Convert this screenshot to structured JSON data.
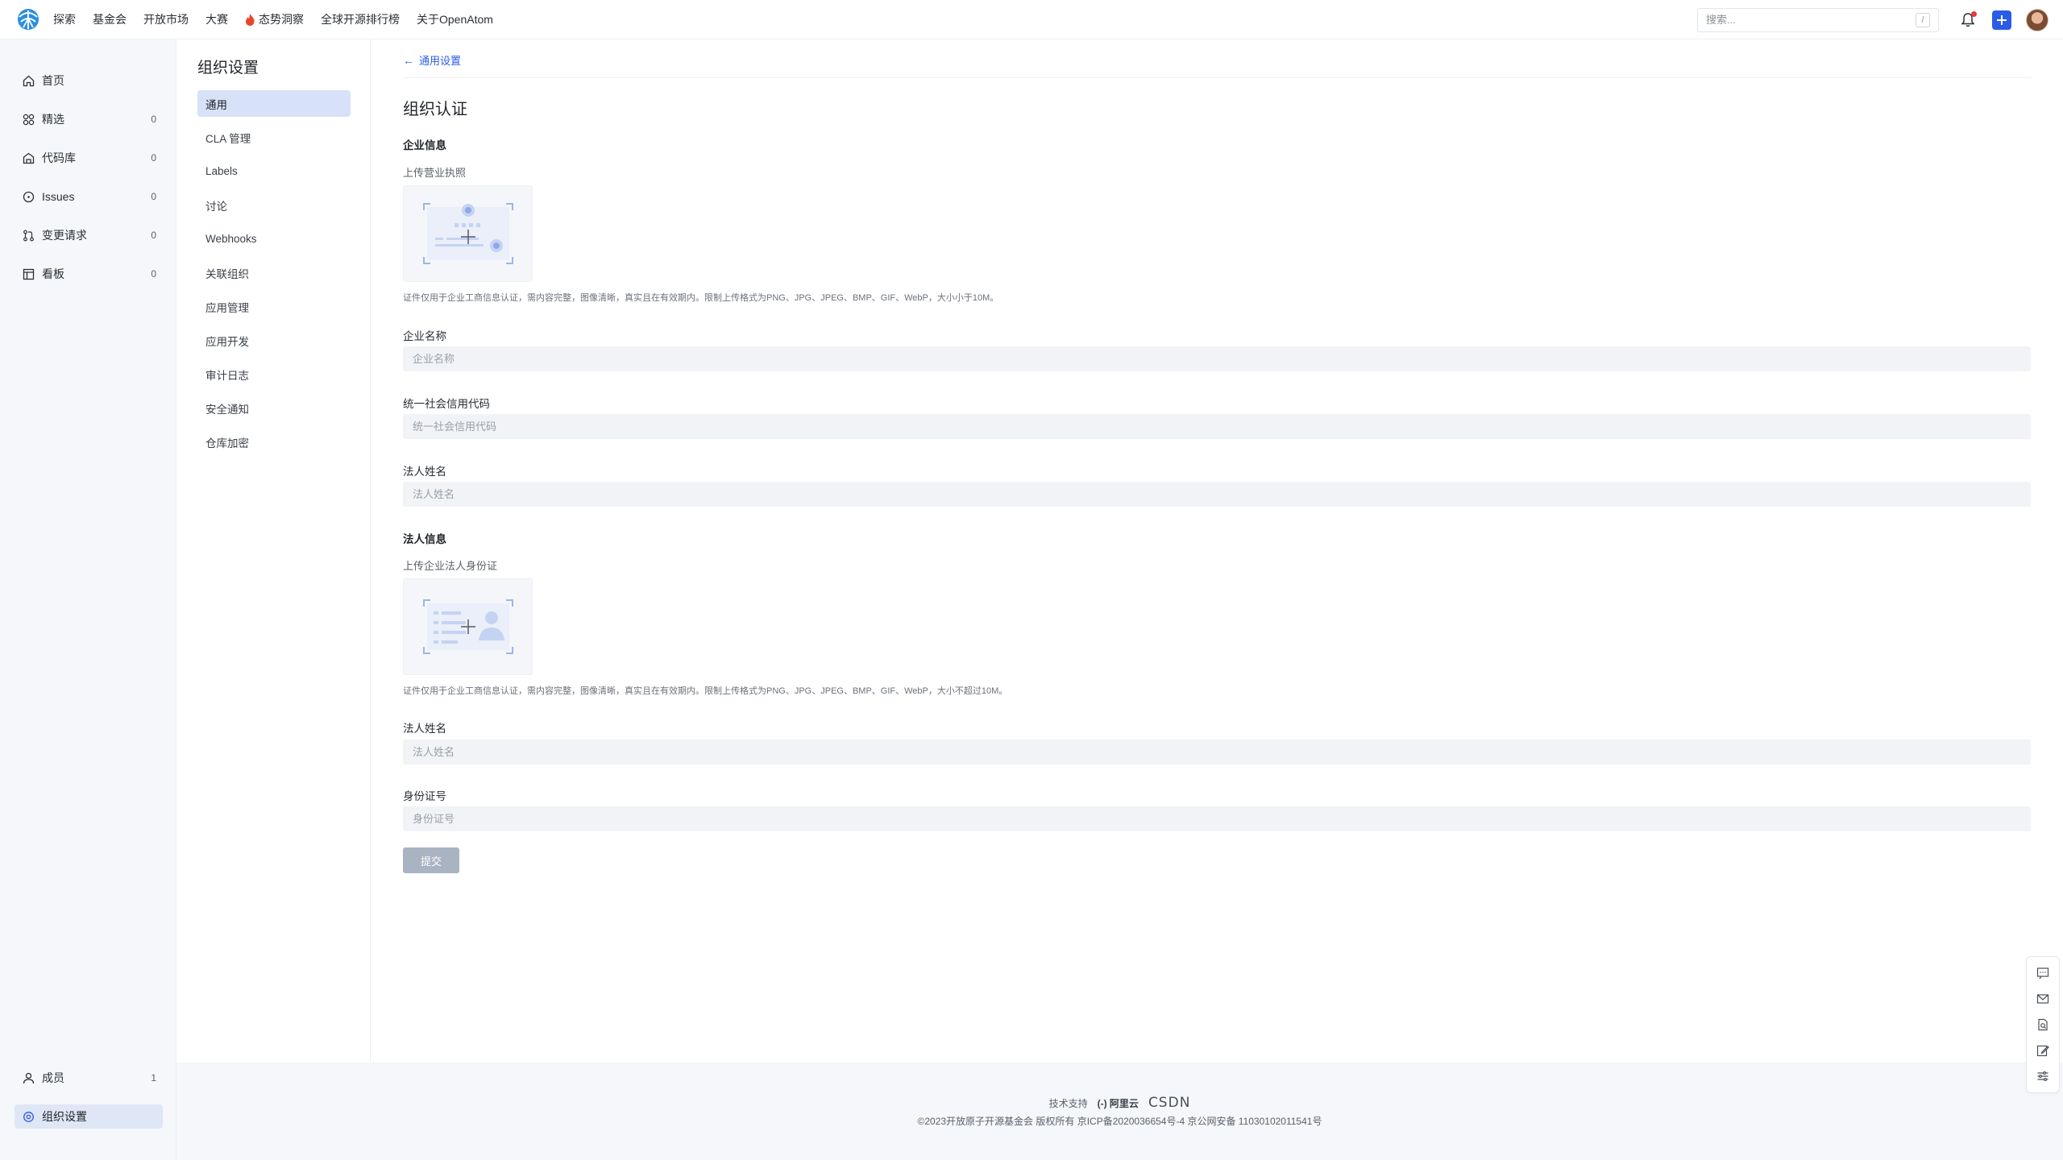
{
  "topnav": {
    "items": [
      "探索",
      "基金会",
      "开放市场",
      "大赛",
      "态势洞察",
      "全球开源排行榜",
      "关于OpenAtom"
    ],
    "search_placeholder": "搜索...",
    "search_shortcut": "/"
  },
  "sidebar": {
    "items": [
      {
        "label": "首页",
        "count": "",
        "icon": "home-icon"
      },
      {
        "label": "精选",
        "count": "0",
        "icon": "grid-icon"
      },
      {
        "label": "代码库",
        "count": "0",
        "icon": "repo-icon"
      },
      {
        "label": "Issues",
        "count": "0",
        "icon": "issue-icon"
      },
      {
        "label": "变更请求",
        "count": "0",
        "icon": "pull-request-icon"
      },
      {
        "label": "看板",
        "count": "0",
        "icon": "board-icon"
      }
    ],
    "bottom": [
      {
        "label": "成员",
        "count": "1",
        "icon": "user-icon"
      },
      {
        "label": "组织设置",
        "count": "",
        "icon": "settings-icon"
      }
    ]
  },
  "settings": {
    "title": "组织设置",
    "menu": [
      "通用",
      "CLA 管理",
      "Labels",
      "讨论",
      "Webhooks",
      "关联组织",
      "应用管理",
      "应用开发",
      "审计日志",
      "安全通知",
      "仓库加密"
    ]
  },
  "main": {
    "back_label": "通用设置",
    "page_title": "组织认证",
    "company_section": "企业信息",
    "upload_license_label": "上传营业执照",
    "license_hint": "证件仅用于企业工商信息认证，需内容完整，图像清晰，真实且在有效期内。限制上传格式为PNG、JPG、JPEG、BMP、GIF、WebP，大小小于10M。",
    "company_name_label": "企业名称",
    "company_name_placeholder": "企业名称",
    "credit_code_label": "统一社会信用代码",
    "credit_code_placeholder": "统一社会信用代码",
    "legal_name_label": "法人姓名",
    "legal_name_placeholder": "法人姓名",
    "legal_section": "法人信息",
    "upload_id_label": "上传企业法人身份证",
    "id_hint": "证件仅用于企业工商信息认证，需内容完整，图像清晰，真实且在有效期内。限制上传格式为PNG、JPG、JPEG、BMP、GIF、WebP，大小不超过10M。",
    "legal_name2_label": "法人姓名",
    "legal_name2_placeholder": "法人姓名",
    "id_number_label": "身份证号",
    "id_number_placeholder": "身份证号",
    "submit_label": "提交"
  },
  "footer": {
    "support_label": "技术支持",
    "aliyun": "(-) 阿里云",
    "csdn": "CSDN",
    "copyright": "©2023开放原子开源基金会 版权所有  京ICP备2020036654号-4  京公网安备 11030102011541号"
  },
  "colors": {
    "accent": "#2b5ce6",
    "active_bg": "#d7e1f8",
    "notification_dot": "#e5383b"
  }
}
